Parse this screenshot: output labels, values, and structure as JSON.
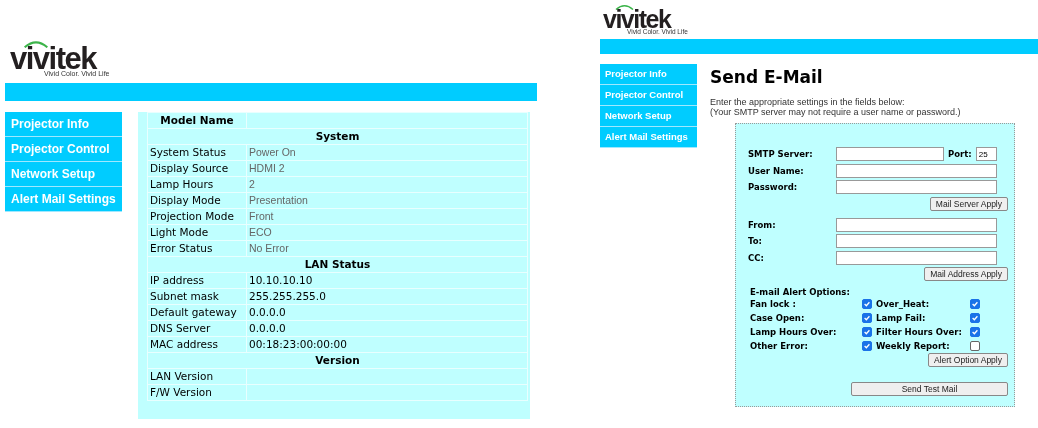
{
  "info_page": {
    "logo": {
      "wordmark": "vivitek",
      "tagline": "Vivid Color. Vivid Life"
    },
    "nav": [
      "Projector Info",
      "Projector Control",
      "Network Setup",
      "Alert Mail Settings"
    ],
    "table": {
      "model_label": "Model Name",
      "sections": [
        {
          "title": "System",
          "muted": true,
          "rows": [
            {
              "label": "System Status",
              "value": "Power On"
            },
            {
              "label": "Display Source",
              "value": "HDMI 2"
            },
            {
              "label": "Lamp Hours",
              "value": "2"
            },
            {
              "label": "Display Mode",
              "value": "Presentation"
            },
            {
              "label": "Projection Mode",
              "value": "Front"
            },
            {
              "label": "Light Mode",
              "value": "ECO"
            },
            {
              "label": "Error Status",
              "value": "No Error"
            }
          ]
        },
        {
          "title": "LAN Status",
          "muted": false,
          "rows": [
            {
              "label": "IP address",
              "value": "10.10.10.10"
            },
            {
              "label": "Subnet mask",
              "value": "255.255.255.0"
            },
            {
              "label": "Default gateway",
              "value": "0.0.0.0"
            },
            {
              "label": "DNS Server",
              "value": "0.0.0.0"
            },
            {
              "label": "MAC address",
              "value": "00:18:23:00:00:00"
            }
          ]
        },
        {
          "title": "Version",
          "rows": [
            {
              "label": "LAN Version"
            },
            {
              "label": "F/W Version"
            }
          ]
        }
      ]
    }
  },
  "mail_page": {
    "logo": {
      "wordmark": "vivitek",
      "tagline": "Vivid Color. Vivid Life"
    },
    "nav": [
      "Projector Info",
      "Projector Control",
      "Network Setup",
      "Alert Mail Settings"
    ],
    "title": "Send E-Mail",
    "instructions": [
      "Enter the appropriate settings in the fields below:",
      "(Your SMTP server may not require a user name or password.)"
    ],
    "groups": [
      {
        "fields": [
          {
            "label": "SMTP Server:",
            "port": {
              "label": "Port:",
              "value": "25"
            }
          },
          {
            "label": "User Name:"
          },
          {
            "label": "Password:"
          }
        ],
        "button": "Mail Server Apply"
      },
      {
        "fields": [
          {
            "label": "From:"
          },
          {
            "label": "To:"
          },
          {
            "label": "CC:"
          }
        ],
        "button": "Mail Address Apply"
      }
    ],
    "alert": {
      "title": "E-mail Alert Options:",
      "options": [
        {
          "label": "Fan lock :",
          "checked": true
        },
        {
          "label": "Over_Heat:",
          "checked": true
        },
        {
          "label": "Case Open:",
          "checked": true
        },
        {
          "label": "Lamp Fail:",
          "checked": true
        },
        {
          "label": "Lamp Hours Over:",
          "checked": true
        },
        {
          "label": "Filter Hours Over:",
          "checked": true
        },
        {
          "label": "Other Error:",
          "checked": true
        },
        {
          "label": "Weekly Report:",
          "checked": false
        }
      ],
      "button": "Alert Option Apply"
    },
    "test_button": "Send Test Mail"
  }
}
